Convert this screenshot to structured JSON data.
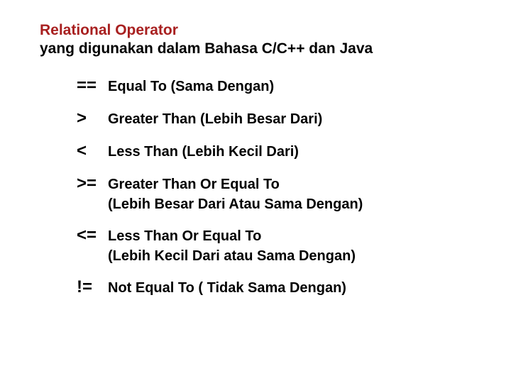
{
  "header": {
    "title_red": "Relational Operator",
    "title_sub": "yang digunakan dalam Bahasa C/C++ dan Java"
  },
  "operators": [
    {
      "sym": "==",
      "desc1": "Equal To  (Sama Dengan)",
      "desc2": ""
    },
    {
      "sym": ">",
      "desc1": "Greater Than (Lebih Besar Dari)",
      "desc2": ""
    },
    {
      "sym": "<",
      "desc1": "Less Than (Lebih Kecil Dari)",
      "desc2": ""
    },
    {
      "sym": ">=",
      "desc1": "Greater Than Or Equal To",
      "desc2": "(Lebih Besar Dari Atau Sama Dengan)"
    },
    {
      "sym": "<=",
      "desc1": "Less Than Or Equal To",
      "desc2": "(Lebih Kecil Dari atau Sama Dengan)"
    },
    {
      "sym": "!=",
      "desc1": "Not Equal To ( Tidak Sama Dengan)",
      "desc2": ""
    }
  ]
}
